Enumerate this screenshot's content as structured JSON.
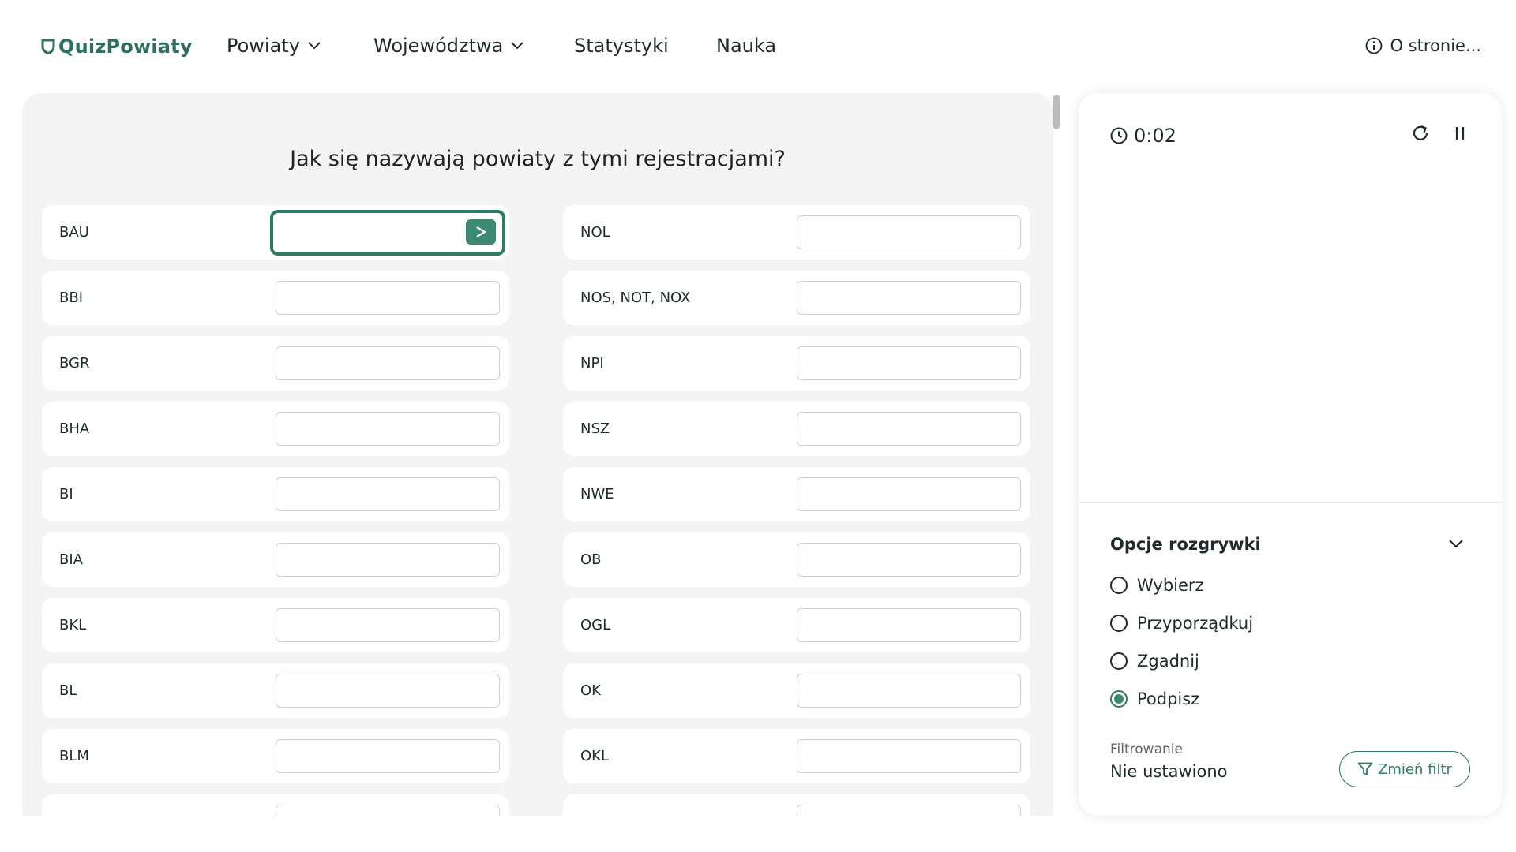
{
  "nav": {
    "logo": "QuizPowiaty",
    "items": [
      {
        "label": "Powiaty",
        "dropdown": true
      },
      {
        "label": "Województwa",
        "dropdown": true
      },
      {
        "label": "Statystyki",
        "dropdown": false
      },
      {
        "label": "Nauka",
        "dropdown": false
      }
    ],
    "about": "O stronie..."
  },
  "quiz": {
    "question": "Jak się nazywają powiaty z tymi rejestracjami?",
    "left_codes": [
      "BAU",
      "BBI",
      "BGR",
      "BHA",
      "BI",
      "BIA",
      "BKL",
      "BL",
      "BLM"
    ],
    "right_codes": [
      "NOL",
      "NOS, NOT, NOX",
      "NPI",
      "NSZ",
      "NWE",
      "OB",
      "OGL",
      "OK",
      "OKL"
    ],
    "active_input": "BAU"
  },
  "side": {
    "timer": "0:02",
    "options_title": "Opcje rozgrywki",
    "modes": [
      {
        "label": "Wybierz",
        "checked": false
      },
      {
        "label": "Przyporządkuj",
        "checked": false
      },
      {
        "label": "Zgadnij",
        "checked": false
      },
      {
        "label": "Podpisz",
        "checked": true
      }
    ],
    "filter_label": "Filtrowanie",
    "filter_value": "Nie ustawiono",
    "filter_button": "Zmień filtr"
  },
  "colors": {
    "accent": "#2f7a63",
    "panel_bg": "#f4f4f4"
  }
}
